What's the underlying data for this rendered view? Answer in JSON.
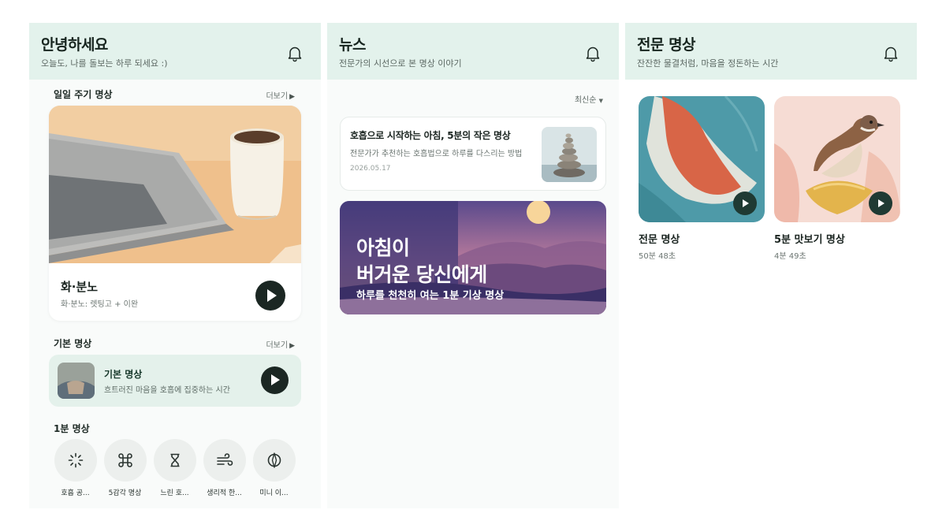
{
  "home": {
    "title": "안녕하세요",
    "subtitle": "오늘도, 나를 돌보는 하루 되세요 :)",
    "daily_section": {
      "title": "일일 주기 명상",
      "more": "더보기"
    },
    "featured": {
      "title": "화·분노",
      "subtitle": "화·분노: 렛팅고 + 이완"
    },
    "basic_section": {
      "title": "기본 명상",
      "more": "더보기"
    },
    "basic_card": {
      "title": "기본 명상",
      "subtitle": "흐트러진 마음을 호흡에 집중하는 시간"
    },
    "one_min_section": {
      "title": "1분 명상"
    },
    "one_min_items": [
      {
        "label": "호흡 공...",
        "icon": "sparkle-icon"
      },
      {
        "label": "5감각 명상",
        "icon": "command-icon"
      },
      {
        "label": "느린 호...",
        "icon": "hourglass-icon"
      },
      {
        "label": "생리적 한...",
        "icon": "wind-icon"
      },
      {
        "label": "미니 이...",
        "icon": "compass-icon"
      }
    ]
  },
  "news": {
    "title": "뉴스",
    "subtitle": "전문가의 시선으로 본 명상 이야기",
    "sort": "최신순",
    "article": {
      "title": "호흡으로 시작하는 아침, 5분의 작은 명상",
      "summary": "전문가가 추천하는 호흡법으로 하루를 다스리는 방법",
      "date": "2026.05.17"
    },
    "banner": {
      "line1": "아침이",
      "line2": "버거운 당신에게",
      "line3": "하루를 천천히 여는 1분 기상 명상"
    }
  },
  "expert": {
    "title": "전문 명상",
    "subtitle": "잔잔한 물결처럼, 마음을 정돈하는 시간",
    "tiles": [
      {
        "title": "전문 명상",
        "duration": "50분 48초"
      },
      {
        "title": "5분 맛보기 명상",
        "duration": "4분 49초"
      }
    ]
  },
  "colors": {
    "header_bg": "#e3f2ec",
    "play_button": "#1b2723",
    "accent_card": "#e4f1eb"
  }
}
